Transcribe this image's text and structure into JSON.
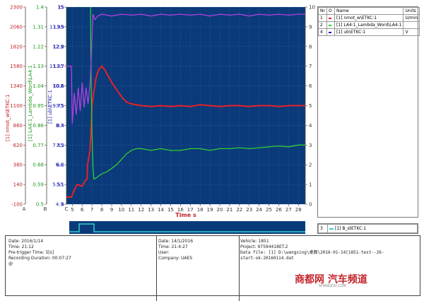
{
  "chart_data": {
    "type": "line",
    "xlabel": "Time s",
    "x_ticks": [
      5,
      6,
      7,
      8,
      9,
      10,
      11,
      12,
      13,
      14,
      15,
      16,
      17,
      18,
      19,
      20,
      21,
      22,
      23,
      24,
      25,
      26,
      27,
      28
    ],
    "axis_letters": [
      "A",
      "B",
      "C"
    ],
    "left_axes": [
      {
        "label": "[1] nmot_w\\ETKC:1",
        "color": "#c0202a",
        "ticks": [
          -100,
          140,
          380,
          620,
          860,
          1100,
          1340,
          1580,
          1820,
          2060,
          2300
        ]
      },
      {
        "label": "[1] LA4:1_Lambda_Word\\LA4:1",
        "color": "#1a9a1a",
        "ticks": [
          0.5,
          0.59,
          0.68,
          0.77,
          0.86,
          0.95,
          1.04,
          1.13,
          1.22,
          1.31,
          1.4
        ]
      },
      {
        "label": "[1] ub\\ETKC:1",
        "color": "#1a1ab0",
        "ticks": [
          4.5,
          5.55,
          6.6,
          7.65,
          8.7,
          9.75,
          10.8,
          11.85,
          12.9,
          13.95,
          15
        ]
      }
    ],
    "inner_left_ticks": [
      4,
      5.1,
      6.2,
      7.3,
      8.4,
      9.5,
      10.6,
      11.7,
      12.8,
      13.9,
      15
    ],
    "right_ticks": [
      0,
      1,
      2,
      3,
      4,
      5,
      6,
      7,
      8,
      9,
      10
    ],
    "series": [
      {
        "name": "[1] nmot_w\\ETKC:1",
        "color": "#e8202a",
        "x": [
          4.4,
          4.9,
          5.3,
          5.5,
          6.0,
          6.3,
          6.5,
          6.55,
          6.7,
          6.8,
          7.0,
          7.2,
          7.4,
          7.6,
          7.8,
          8.0,
          8.3,
          8.6,
          9.0,
          9.5,
          10,
          10.5,
          11,
          12,
          13,
          14,
          15,
          16,
          17,
          18,
          19,
          20,
          21,
          22,
          23,
          24,
          25,
          26,
          27,
          28,
          28.7
        ],
        "y": [
          4.4,
          4.4,
          4.9,
          5.1,
          5.0,
          5.3,
          5.4,
          6.2,
          6.7,
          7.0,
          9.5,
          10.3,
          11.0,
          11.4,
          11.6,
          11.7,
          11.5,
          11.2,
          10.8,
          10.4,
          10.0,
          9.7,
          9.6,
          9.5,
          9.45,
          9.5,
          9.45,
          9.5,
          9.45,
          9.55,
          9.5,
          9.45,
          9.5,
          9.5,
          9.45,
          9.5,
          9.5,
          9.45,
          9.5,
          9.5,
          9.5
        ]
      },
      {
        "name": "[1] LA4:1_Lambda_Word\\LA4:1",
        "color": "#30d030",
        "x": [
          6.85,
          6.9,
          7.0,
          7.1,
          7.2,
          7.5,
          8.0,
          8.5,
          9.0,
          9.5,
          10.0,
          10.5,
          11,
          11.5,
          12,
          13,
          14,
          15,
          16,
          17,
          18,
          19,
          20,
          21,
          22,
          23,
          24,
          25,
          26,
          27,
          28,
          28.7
        ],
        "y": [
          15,
          11.0,
          8.0,
          6.0,
          5.4,
          5.5,
          5.7,
          5.8,
          6.0,
          6.2,
          6.5,
          6.8,
          7.0,
          7.1,
          7.1,
          7.0,
          7.1,
          7.0,
          7.0,
          7.1,
          7.1,
          7.0,
          7.1,
          7.1,
          7.15,
          7.1,
          7.15,
          7.2,
          7.25,
          7.2,
          7.3,
          7.3
        ]
      },
      {
        "name": "[1] ub\\ETKC:1",
        "color": "#b040e0",
        "x": [
          4.4,
          4.9,
          5.0,
          5.2,
          5.4,
          5.6,
          5.8,
          6.0,
          6.2,
          6.4,
          6.6,
          6.8,
          7.0,
          7.1,
          7.3,
          7.6,
          8,
          9,
          10,
          11,
          12,
          13,
          14,
          15,
          16,
          17,
          18,
          19,
          20,
          21,
          22,
          23,
          24,
          25,
          26,
          27,
          28,
          28.7
        ],
        "y": [
          11.7,
          11.7,
          8.5,
          10.2,
          9.0,
          10.5,
          9.2,
          10.8,
          9.4,
          10.5,
          9.6,
          10.7,
          13.2,
          14.6,
          14.3,
          14.5,
          14.6,
          14.5,
          14.6,
          14.55,
          14.6,
          14.5,
          14.6,
          14.55,
          14.6,
          14.55,
          14.6,
          14.5,
          14.6,
          14.55,
          14.6,
          14.5,
          14.6,
          14.55,
          14.6,
          14.55,
          14.6,
          14.6
        ]
      }
    ],
    "overview": {
      "name": "[1] B_stETKC:1",
      "color": "#30d0d0"
    }
  },
  "legend": {
    "headers": [
      "Nr",
      "O",
      "Name",
      "Units"
    ],
    "rows": [
      {
        "nr": "1",
        "name": "[1] nmot_w\\ETKC:1",
        "units": "U/min",
        "color": "#e8202a"
      },
      {
        "nr": "2",
        "name": "[1] LA4:1_Lambda_Word\\LA4:1",
        "units": "",
        "color": "#30d030"
      },
      {
        "nr": "4",
        "name": "[1] ub\\ETKC:1",
        "units": "V",
        "color": "#1a1ab0"
      }
    ],
    "overview_row": {
      "nr": "3",
      "name": "[1] B_stETKC:1",
      "color": "#30d0d0"
    }
  },
  "info": {
    "col1": [
      "Date: 2016/1/14",
      "Time: 21:12",
      "Pre-trigger Time: 5[s]",
      "Recording Duration: 00:07:27",
      "@"
    ],
    "col2": [
      "Date: 14/1/2016",
      "Time: 21:4:27",
      "User:",
      "Company: UAES"
    ],
    "col3": [
      "Vehicle: 1851",
      "Project: 97594418ET.2",
      "Data file:  [1] D:\\wangxing\\桌面\\2016-01-14[1851-test--26-",
      "start-ok-20160114.dat"
    ]
  },
  "watermark": {
    "text": "商都网 汽车频道",
    "sub": "SHANGDU.COM"
  }
}
